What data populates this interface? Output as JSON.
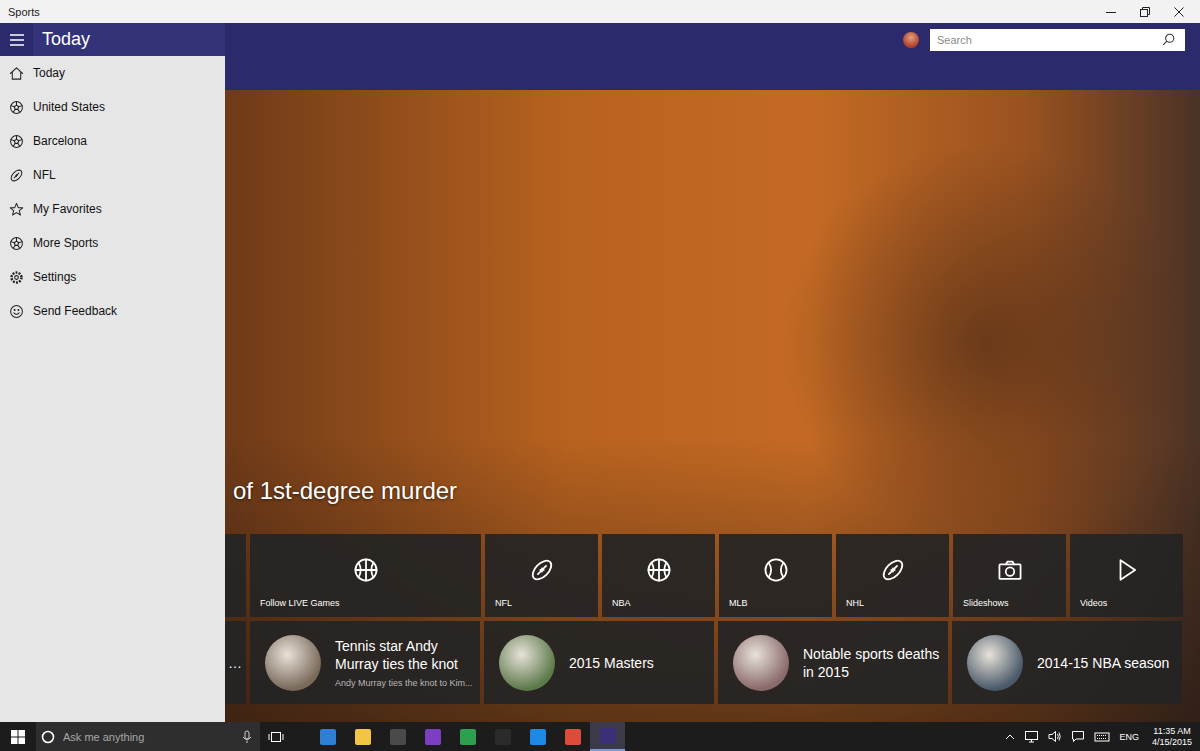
{
  "window": {
    "title": "Sports"
  },
  "header": {
    "title": "Today",
    "search": {
      "placeholder": "Search"
    }
  },
  "sidebar": {
    "items": [
      {
        "label": "Today"
      },
      {
        "label": "United States"
      },
      {
        "label": "Barcelona"
      },
      {
        "label": "NFL"
      },
      {
        "label": "My Favorites"
      },
      {
        "label": "More Sports"
      },
      {
        "label": "Settings"
      },
      {
        "label": "Send Feedback"
      }
    ]
  },
  "hero": {
    "headline": "of 1st-degree murder"
  },
  "quick_links": [
    {
      "label": "Follow LIVE Games",
      "kind": "wide"
    },
    {
      "label": "NFL",
      "kind": "square"
    },
    {
      "label": "NBA",
      "kind": "square"
    },
    {
      "label": "MLB",
      "kind": "square"
    },
    {
      "label": "NHL",
      "kind": "square"
    },
    {
      "label": "Slideshows",
      "kind": "square"
    },
    {
      "label": "Videos",
      "kind": "square"
    }
  ],
  "stories": [
    {
      "title": "…",
      "subtitle": "",
      "kind": "partial"
    },
    {
      "title": "Tennis star Andy Murray ties the knot",
      "subtitle": "Andy Murray ties the knot to Kim...",
      "kind": "story"
    },
    {
      "title": "2015 Masters",
      "subtitle": "",
      "kind": "story"
    },
    {
      "title": "Notable sports deaths in 2015",
      "subtitle": "",
      "kind": "story"
    },
    {
      "title": "2014-15 NBA season",
      "subtitle": "",
      "kind": "story"
    }
  ],
  "taskbar": {
    "search": {
      "placeholder": "Ask me anything"
    },
    "apps": [
      {
        "color": "#2f7fd6",
        "selected": false
      },
      {
        "color": "#f3c544",
        "selected": false
      },
      {
        "color": "#4a4a4a",
        "selected": false
      },
      {
        "color": "#7b3fc4",
        "selected": false
      },
      {
        "color": "#2e9e4f",
        "selected": false
      },
      {
        "color": "#2b2b2b",
        "selected": false
      },
      {
        "color": "#1e88e5",
        "selected": false
      },
      {
        "color": "#dd4b39",
        "selected": false
      },
      {
        "color": "#3b2f7a",
        "selected": true
      }
    ],
    "tray": {
      "language": "ENG",
      "time": "11:35 AM",
      "date": "4/15/2015"
    }
  }
}
